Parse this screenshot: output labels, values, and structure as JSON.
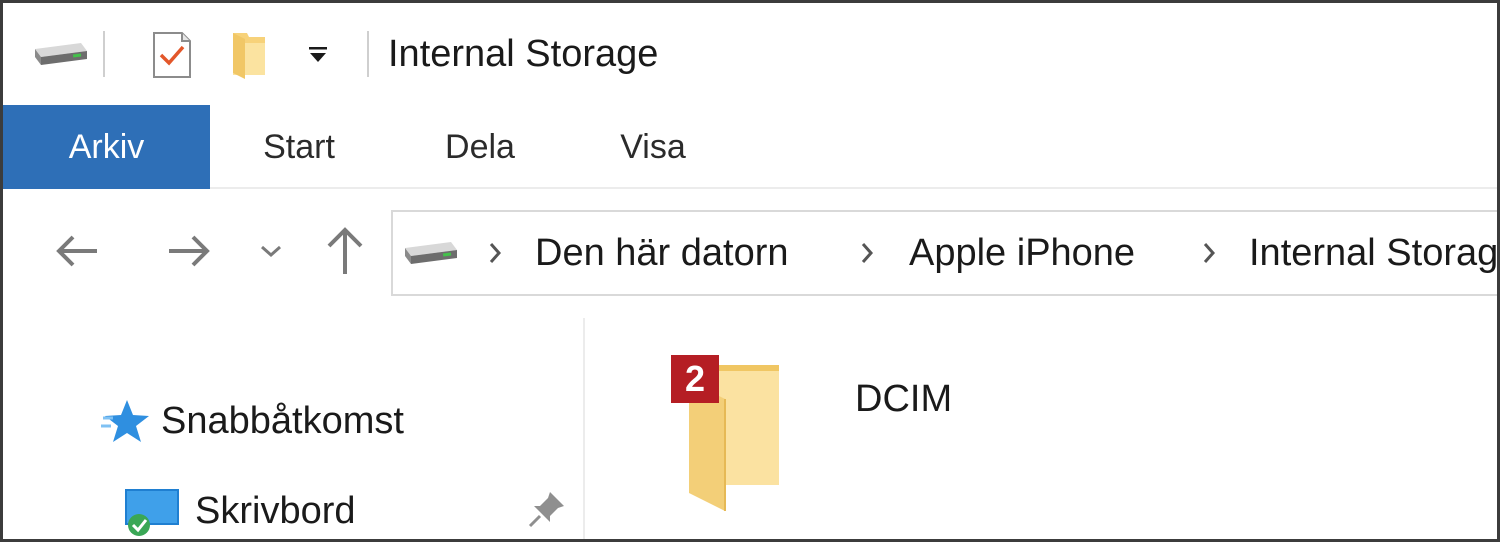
{
  "window": {
    "title": "Internal Storage",
    "accent_color": "#2e6fb7",
    "quick_access": [
      {
        "icon": "drive-icon"
      },
      {
        "icon": "properties-icon"
      },
      {
        "icon": "new-folder-icon"
      },
      {
        "icon": "customize-dropdown-icon"
      }
    ]
  },
  "ribbon": {
    "tabs": [
      {
        "label": "Arkiv",
        "active": true
      },
      {
        "label": "Start",
        "active": false
      },
      {
        "label": "Dela",
        "active": false
      },
      {
        "label": "Visa",
        "active": false
      }
    ]
  },
  "navigation": {
    "back_icon": "back-arrow-icon",
    "forward_icon": "forward-arrow-icon",
    "recent_icon": "chevron-down-icon",
    "up_icon": "up-arrow-icon"
  },
  "address_bar": {
    "icon": "drive-icon",
    "crumbs": [
      "Den här datorn",
      "Apple iPhone",
      "Internal Storage"
    ]
  },
  "nav_pane": {
    "items": [
      {
        "label": "Snabbåtkomst",
        "icon": "star-icon"
      },
      {
        "label": "Skrivbord",
        "icon": "desktop-icon",
        "pinned": true
      }
    ]
  },
  "content": {
    "items": [
      {
        "name": "DCIM",
        "type": "folder",
        "badge": "2",
        "badge_color": "#b51e24"
      }
    ]
  }
}
